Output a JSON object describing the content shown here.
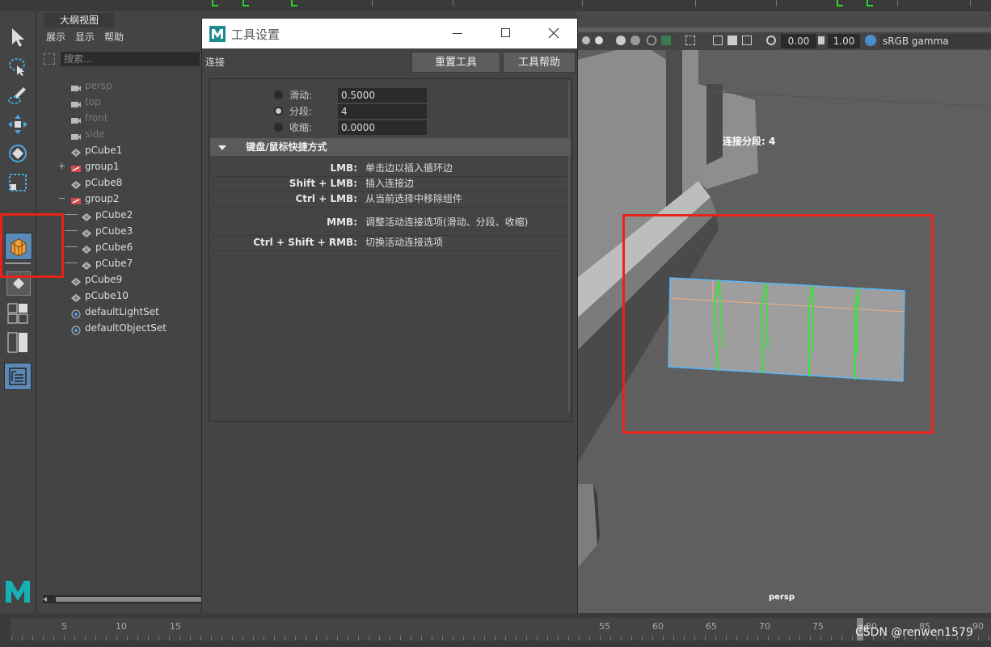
{
  "outliner": {
    "tab": "大纲视图",
    "menu": [
      "展示",
      "显示",
      "帮助"
    ],
    "search_placeholder": "搜索...",
    "items": [
      {
        "label": "persp",
        "type": "camera",
        "dim": true
      },
      {
        "label": "top",
        "type": "camera",
        "dim": true
      },
      {
        "label": "front",
        "type": "camera",
        "dim": true
      },
      {
        "label": "side",
        "type": "camera",
        "dim": true
      },
      {
        "label": "pCube1",
        "type": "mesh"
      },
      {
        "label": "group1",
        "type": "group",
        "expand": "+"
      },
      {
        "label": "pCube8",
        "type": "mesh"
      },
      {
        "label": "group2",
        "type": "group",
        "expand": "−"
      },
      {
        "label": "pCube2",
        "type": "mesh",
        "child": true
      },
      {
        "label": "pCube3",
        "type": "mesh",
        "child": true
      },
      {
        "label": "pCube6",
        "type": "mesh",
        "child": true
      },
      {
        "label": "pCube7",
        "type": "mesh",
        "child": true
      },
      {
        "label": "pCube9",
        "type": "mesh"
      },
      {
        "label": "pCube10",
        "type": "mesh"
      },
      {
        "label": "defaultLightSet",
        "type": "set"
      },
      {
        "label": "defaultObjectSet",
        "type": "set"
      }
    ]
  },
  "dialog": {
    "title": "工具设置",
    "tool_name": "连接",
    "reset_button": "重置工具",
    "help_button": "工具帮助",
    "options": [
      {
        "label": "滑动:",
        "value": "0.5000",
        "selected": false
      },
      {
        "label": "分段:",
        "value": "4",
        "selected": true
      },
      {
        "label": "收缩:",
        "value": "0.0000",
        "selected": false
      }
    ],
    "section_title": "键盘/鼠标快捷方式",
    "shortcuts": [
      {
        "key": "LMB:",
        "desc": "单击边以插入循环边"
      },
      {
        "key": "Shift + LMB:",
        "desc": "插入连接边"
      },
      {
        "key": "Ctrl + LMB:",
        "desc": "从当前选择中移除组件"
      },
      {
        "key": "MMB:",
        "desc": "调整活动连接选项(滑动、分段、收缩)"
      },
      {
        "key": "Ctrl + Shift + RMB:",
        "desc": "切换活动连接选项"
      }
    ]
  },
  "viewport": {
    "exposure": "0.00",
    "gamma": "1.00",
    "color_space": "sRGB gamma",
    "hud_label": "连接分段: 4",
    "camera_label": "persp"
  },
  "timeline": {
    "left_ticks": [
      "5",
      "10",
      "15"
    ],
    "right_ticks": [
      "55",
      "60",
      "65",
      "70",
      "75",
      "80",
      "85",
      "90"
    ],
    "current_frame": "79"
  },
  "watermark": "CSDN @renwen1579",
  "colors": {
    "highlight": "#e8231a",
    "edge_green": "#35e635",
    "selection_blue": "#3aa0ff"
  }
}
